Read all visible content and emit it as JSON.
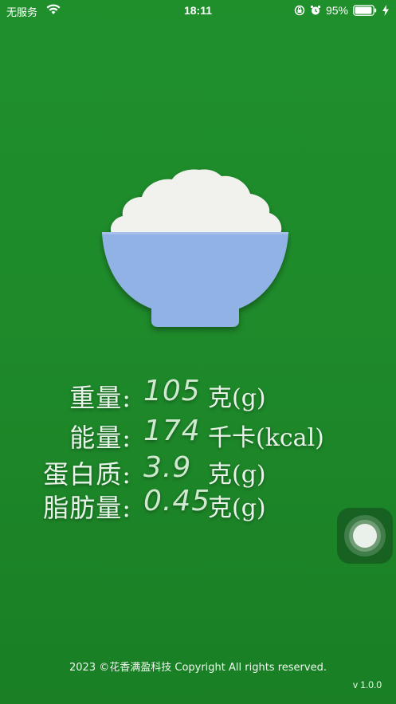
{
  "status_bar": {
    "carrier": "无服务",
    "time": "18:11",
    "battery_percent": "95%",
    "battery_level": 0.95,
    "icons": [
      "wifi-icon",
      "screen-lock-icon",
      "alarm-icon",
      "battery-icon",
      "charging-icon"
    ]
  },
  "illustration": {
    "name": "rice-bowl",
    "colors": {
      "rice": "#f1f1ee",
      "bowl": "#91b2e4"
    }
  },
  "nutrition": [
    {
      "label": "重量:",
      "value": "105",
      "unit": "克(g)"
    },
    {
      "label": "能量:",
      "value": "174",
      "unit": "千卡(kcal)"
    },
    {
      "label": "蛋白质:",
      "value": "3.9",
      "unit": "克(g)"
    },
    {
      "label": "脂肪量:",
      "value": "0.45",
      "unit": "克(g)"
    }
  ],
  "footer": {
    "copyright": "2023 ©花香满盈科技 Copyright All rights reserved.",
    "version": "v 1.0.0"
  },
  "theme": {
    "background": "#1e8a2a",
    "text": "#ffffff"
  }
}
